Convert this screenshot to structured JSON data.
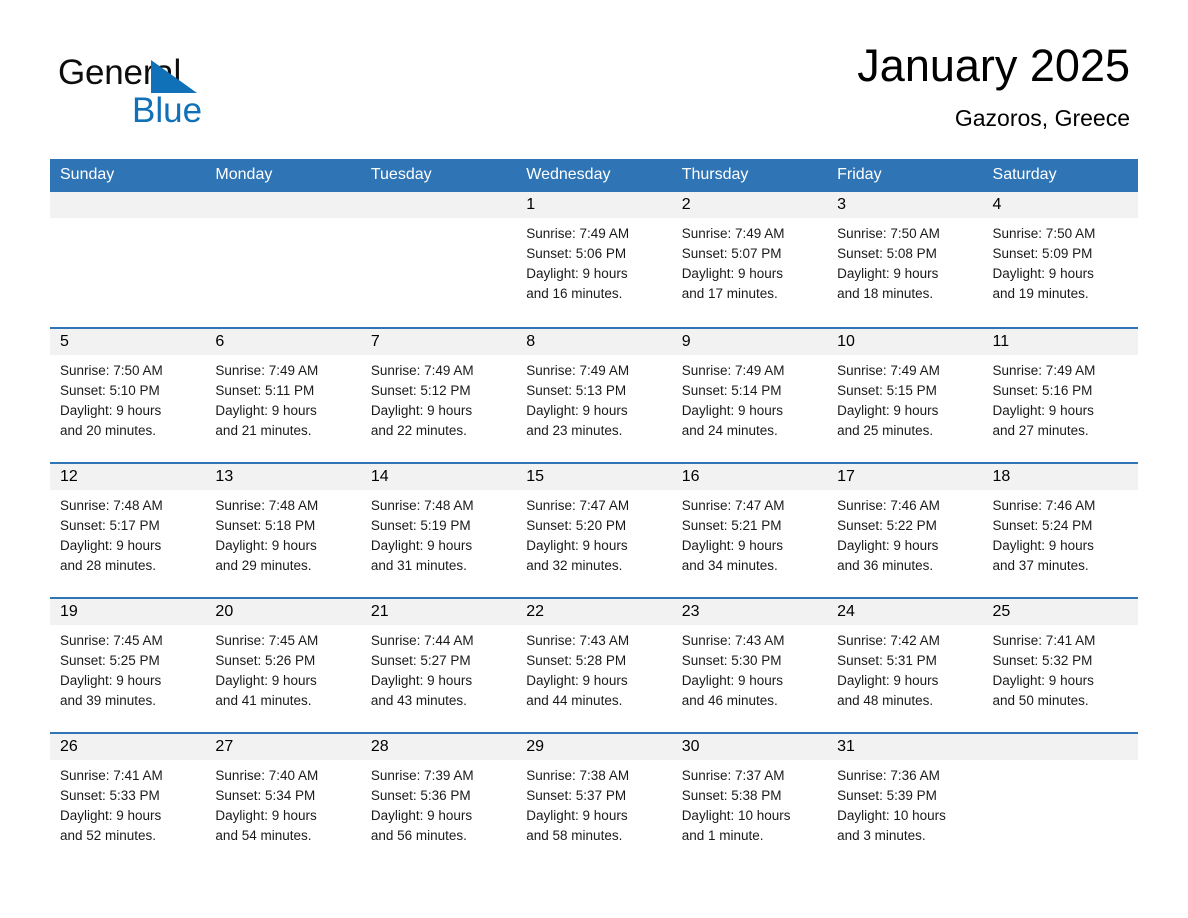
{
  "brand": {
    "name_part1": "General",
    "name_part2": "Blue",
    "flag_color": "#1071b8"
  },
  "header": {
    "title": "January 2025",
    "location": "Gazoros, Greece"
  },
  "theme": {
    "header_blue": "#2f75b5",
    "band_gray": "#f2f2f2"
  },
  "weekday_headers": [
    "Sunday",
    "Monday",
    "Tuesday",
    "Wednesday",
    "Thursday",
    "Friday",
    "Saturday"
  ],
  "weeks": [
    [
      {
        "day": "",
        "sunrise": "",
        "sunset": "",
        "daylight_line1": "",
        "daylight_line2": ""
      },
      {
        "day": "",
        "sunrise": "",
        "sunset": "",
        "daylight_line1": "",
        "daylight_line2": ""
      },
      {
        "day": "",
        "sunrise": "",
        "sunset": "",
        "daylight_line1": "",
        "daylight_line2": ""
      },
      {
        "day": "1",
        "sunrise": "Sunrise: 7:49 AM",
        "sunset": "Sunset: 5:06 PM",
        "daylight_line1": "Daylight: 9 hours",
        "daylight_line2": "and 16 minutes."
      },
      {
        "day": "2",
        "sunrise": "Sunrise: 7:49 AM",
        "sunset": "Sunset: 5:07 PM",
        "daylight_line1": "Daylight: 9 hours",
        "daylight_line2": "and 17 minutes."
      },
      {
        "day": "3",
        "sunrise": "Sunrise: 7:50 AM",
        "sunset": "Sunset: 5:08 PM",
        "daylight_line1": "Daylight: 9 hours",
        "daylight_line2": "and 18 minutes."
      },
      {
        "day": "4",
        "sunrise": "Sunrise: 7:50 AM",
        "sunset": "Sunset: 5:09 PM",
        "daylight_line1": "Daylight: 9 hours",
        "daylight_line2": "and 19 minutes."
      }
    ],
    [
      {
        "day": "5",
        "sunrise": "Sunrise: 7:50 AM",
        "sunset": "Sunset: 5:10 PM",
        "daylight_line1": "Daylight: 9 hours",
        "daylight_line2": "and 20 minutes."
      },
      {
        "day": "6",
        "sunrise": "Sunrise: 7:49 AM",
        "sunset": "Sunset: 5:11 PM",
        "daylight_line1": "Daylight: 9 hours",
        "daylight_line2": "and 21 minutes."
      },
      {
        "day": "7",
        "sunrise": "Sunrise: 7:49 AM",
        "sunset": "Sunset: 5:12 PM",
        "daylight_line1": "Daylight: 9 hours",
        "daylight_line2": "and 22 minutes."
      },
      {
        "day": "8",
        "sunrise": "Sunrise: 7:49 AM",
        "sunset": "Sunset: 5:13 PM",
        "daylight_line1": "Daylight: 9 hours",
        "daylight_line2": "and 23 minutes."
      },
      {
        "day": "9",
        "sunrise": "Sunrise: 7:49 AM",
        "sunset": "Sunset: 5:14 PM",
        "daylight_line1": "Daylight: 9 hours",
        "daylight_line2": "and 24 minutes."
      },
      {
        "day": "10",
        "sunrise": "Sunrise: 7:49 AM",
        "sunset": "Sunset: 5:15 PM",
        "daylight_line1": "Daylight: 9 hours",
        "daylight_line2": "and 25 minutes."
      },
      {
        "day": "11",
        "sunrise": "Sunrise: 7:49 AM",
        "sunset": "Sunset: 5:16 PM",
        "daylight_line1": "Daylight: 9 hours",
        "daylight_line2": "and 27 minutes."
      }
    ],
    [
      {
        "day": "12",
        "sunrise": "Sunrise: 7:48 AM",
        "sunset": "Sunset: 5:17 PM",
        "daylight_line1": "Daylight: 9 hours",
        "daylight_line2": "and 28 minutes."
      },
      {
        "day": "13",
        "sunrise": "Sunrise: 7:48 AM",
        "sunset": "Sunset: 5:18 PM",
        "daylight_line1": "Daylight: 9 hours",
        "daylight_line2": "and 29 minutes."
      },
      {
        "day": "14",
        "sunrise": "Sunrise: 7:48 AM",
        "sunset": "Sunset: 5:19 PM",
        "daylight_line1": "Daylight: 9 hours",
        "daylight_line2": "and 31 minutes."
      },
      {
        "day": "15",
        "sunrise": "Sunrise: 7:47 AM",
        "sunset": "Sunset: 5:20 PM",
        "daylight_line1": "Daylight: 9 hours",
        "daylight_line2": "and 32 minutes."
      },
      {
        "day": "16",
        "sunrise": "Sunrise: 7:47 AM",
        "sunset": "Sunset: 5:21 PM",
        "daylight_line1": "Daylight: 9 hours",
        "daylight_line2": "and 34 minutes."
      },
      {
        "day": "17",
        "sunrise": "Sunrise: 7:46 AM",
        "sunset": "Sunset: 5:22 PM",
        "daylight_line1": "Daylight: 9 hours",
        "daylight_line2": "and 36 minutes."
      },
      {
        "day": "18",
        "sunrise": "Sunrise: 7:46 AM",
        "sunset": "Sunset: 5:24 PM",
        "daylight_line1": "Daylight: 9 hours",
        "daylight_line2": "and 37 minutes."
      }
    ],
    [
      {
        "day": "19",
        "sunrise": "Sunrise: 7:45 AM",
        "sunset": "Sunset: 5:25 PM",
        "daylight_line1": "Daylight: 9 hours",
        "daylight_line2": "and 39 minutes."
      },
      {
        "day": "20",
        "sunrise": "Sunrise: 7:45 AM",
        "sunset": "Sunset: 5:26 PM",
        "daylight_line1": "Daylight: 9 hours",
        "daylight_line2": "and 41 minutes."
      },
      {
        "day": "21",
        "sunrise": "Sunrise: 7:44 AM",
        "sunset": "Sunset: 5:27 PM",
        "daylight_line1": "Daylight: 9 hours",
        "daylight_line2": "and 43 minutes."
      },
      {
        "day": "22",
        "sunrise": "Sunrise: 7:43 AM",
        "sunset": "Sunset: 5:28 PM",
        "daylight_line1": "Daylight: 9 hours",
        "daylight_line2": "and 44 minutes."
      },
      {
        "day": "23",
        "sunrise": "Sunrise: 7:43 AM",
        "sunset": "Sunset: 5:30 PM",
        "daylight_line1": "Daylight: 9 hours",
        "daylight_line2": "and 46 minutes."
      },
      {
        "day": "24",
        "sunrise": "Sunrise: 7:42 AM",
        "sunset": "Sunset: 5:31 PM",
        "daylight_line1": "Daylight: 9 hours",
        "daylight_line2": "and 48 minutes."
      },
      {
        "day": "25",
        "sunrise": "Sunrise: 7:41 AM",
        "sunset": "Sunset: 5:32 PM",
        "daylight_line1": "Daylight: 9 hours",
        "daylight_line2": "and 50 minutes."
      }
    ],
    [
      {
        "day": "26",
        "sunrise": "Sunrise: 7:41 AM",
        "sunset": "Sunset: 5:33 PM",
        "daylight_line1": "Daylight: 9 hours",
        "daylight_line2": "and 52 minutes."
      },
      {
        "day": "27",
        "sunrise": "Sunrise: 7:40 AM",
        "sunset": "Sunset: 5:34 PM",
        "daylight_line1": "Daylight: 9 hours",
        "daylight_line2": "and 54 minutes."
      },
      {
        "day": "28",
        "sunrise": "Sunrise: 7:39 AM",
        "sunset": "Sunset: 5:36 PM",
        "daylight_line1": "Daylight: 9 hours",
        "daylight_line2": "and 56 minutes."
      },
      {
        "day": "29",
        "sunrise": "Sunrise: 7:38 AM",
        "sunset": "Sunset: 5:37 PM",
        "daylight_line1": "Daylight: 9 hours",
        "daylight_line2": "and 58 minutes."
      },
      {
        "day": "30",
        "sunrise": "Sunrise: 7:37 AM",
        "sunset": "Sunset: 5:38 PM",
        "daylight_line1": "Daylight: 10 hours",
        "daylight_line2": "and 1 minute."
      },
      {
        "day": "31",
        "sunrise": "Sunrise: 7:36 AM",
        "sunset": "Sunset: 5:39 PM",
        "daylight_line1": "Daylight: 10 hours",
        "daylight_line2": "and 3 minutes."
      },
      {
        "day": "",
        "sunrise": "",
        "sunset": "",
        "daylight_line1": "",
        "daylight_line2": ""
      }
    ]
  ]
}
